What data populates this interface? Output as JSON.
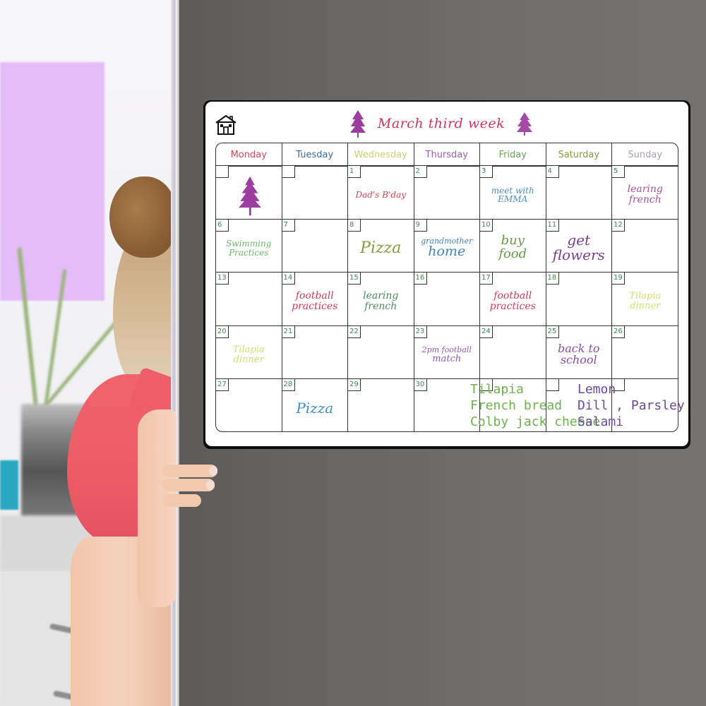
{
  "board": {
    "title": "March third week",
    "title_color": "#d2355c",
    "tree_color": "#9b3ea0",
    "icons": [
      "house-icon",
      "tree-icon"
    ],
    "weekdays": [
      {
        "label": "Monday",
        "color": "#d9445a"
      },
      {
        "label": "Tuesday",
        "color": "#3e6e9e"
      },
      {
        "label": "Wednesday",
        "color": "#c9d46a"
      },
      {
        "label": "Thursday",
        "color": "#9a5fa8"
      },
      {
        "label": "Friday",
        "color": "#6aa25a"
      },
      {
        "label": "Saturday",
        "color": "#8c9a3c"
      },
      {
        "label": "Sunday",
        "color": "#a9a2b2"
      }
    ],
    "weeks": [
      [
        {
          "date": "",
          "note": "",
          "icon": "tree-icon"
        },
        {
          "date": "",
          "note": ""
        },
        {
          "date": "1",
          "note": "Dad's B'day",
          "color": "#d9445a",
          "size": 12
        },
        {
          "date": "2",
          "note": ""
        },
        {
          "date": "3",
          "note": "meet with\nEMMA",
          "color": "#4f8fc4",
          "size": 12
        },
        {
          "date": "4",
          "note": ""
        },
        {
          "date": "5",
          "note": "learing\nfrench",
          "color": "#a4539f",
          "size": 14
        }
      ],
      [
        {
          "date": "6",
          "note": "Swimming\nPractices",
          "color": "#6cb86a",
          "size": 12
        },
        {
          "date": "7",
          "note": ""
        },
        {
          "date": "8",
          "note": "Pizza",
          "color": "#8d9a3a",
          "size": 22
        },
        {
          "date": "9",
          "note": "grandmother\nhome",
          "color": "#3f86b7",
          "size": 11,
          "size2": 19
        },
        {
          "date": "10",
          "note": "buy\nfood",
          "color": "#6a9a4a",
          "size": 18
        },
        {
          "date": "11",
          "note": "get\nflowers",
          "color": "#7e3f93",
          "size": 20
        },
        {
          "date": "12",
          "note": ""
        }
      ],
      [
        {
          "date": "13",
          "note": ""
        },
        {
          "date": "14",
          "note": "football\npractices",
          "color": "#d23c5c",
          "size": 14
        },
        {
          "date": "15",
          "note": "learing\nfrench",
          "color": "#4e8a62",
          "size": 14
        },
        {
          "date": "16",
          "note": ""
        },
        {
          "date": "17",
          "note": "football\npractices",
          "color": "#d23c5c",
          "size": 14
        },
        {
          "date": "18",
          "note": ""
        },
        {
          "date": "19",
          "note": "Tilapia\ndinner",
          "color": "#d4e06a",
          "size": 13
        }
      ],
      [
        {
          "date": "20",
          "note": "Tilapia\ndinner",
          "color": "#d4e06a",
          "size": 13
        },
        {
          "date": "21",
          "note": ""
        },
        {
          "date": "22",
          "note": ""
        },
        {
          "date": "23",
          "note": "2pm football\nmatch",
          "color": "#8c5fa8",
          "size": 11,
          "size2": 13
        },
        {
          "date": "24",
          "note": ""
        },
        {
          "date": "25",
          "note": "back to\nschool",
          "color": "#8a4ea5",
          "size": 16
        },
        {
          "date": "26",
          "note": ""
        }
      ],
      [
        {
          "date": "27",
          "note": ""
        },
        {
          "date": "28",
          "note": "Pizza",
          "color": "#3f8fc0",
          "size": 20
        },
        {
          "date": "29",
          "note": ""
        },
        {
          "date": "30",
          "note": ""
        },
        {
          "date": "",
          "note": ""
        },
        {
          "date": "",
          "note": ""
        },
        {
          "date": "",
          "note": ""
        }
      ]
    ],
    "shopping_list_left": {
      "lines": [
        "Tilapia",
        "French bread",
        "Colby jack cheese"
      ],
      "color": "#6db24e"
    },
    "shopping_list_right": {
      "lines": [
        "Lemon",
        "Dill , Parsley",
        "Salami"
      ],
      "color": "#6a4a9a"
    }
  }
}
